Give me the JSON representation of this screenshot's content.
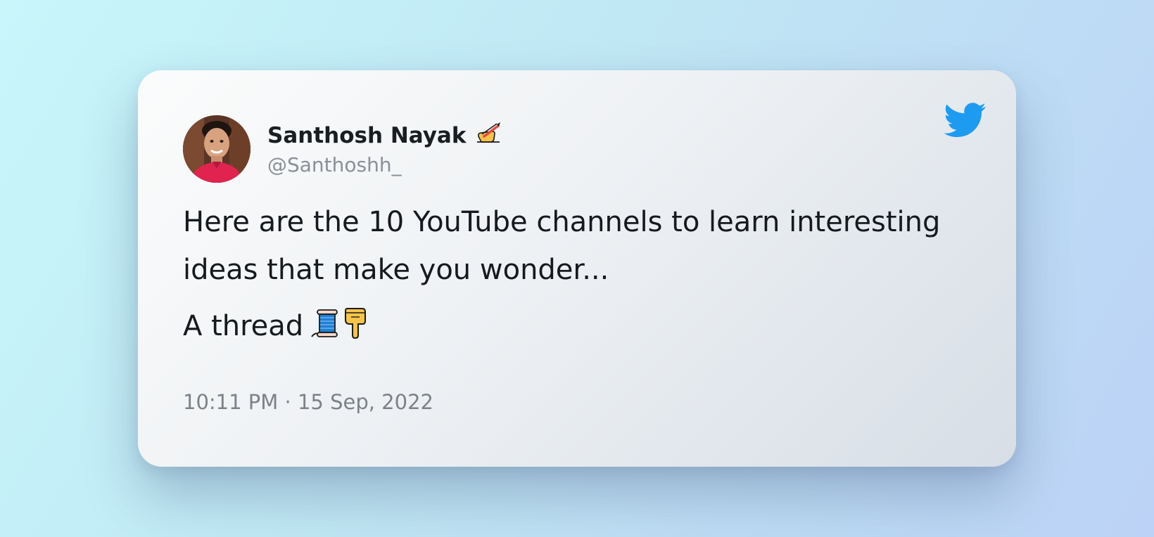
{
  "tweet": {
    "author": {
      "display_name": "Santhosh Nayak",
      "name_emoji_icon": "writing-hand-icon",
      "handle": "@Santhoshh_"
    },
    "text_line1": "Here are the 10 YouTube channels to learn interesting ideas that make you wonder...",
    "text_line2": "A thread",
    "text_line2_icons": [
      "spool-of-thread-icon",
      "backhand-index-pointing-down-icon"
    ],
    "timestamp": "10:11 PM · 15 Sep, 2022",
    "brand_icon": "twitter-bird-icon"
  },
  "colors": {
    "twitter_blue": "#1d9bf0",
    "text_primary": "#16191d",
    "text_muted": "#8a9097"
  }
}
